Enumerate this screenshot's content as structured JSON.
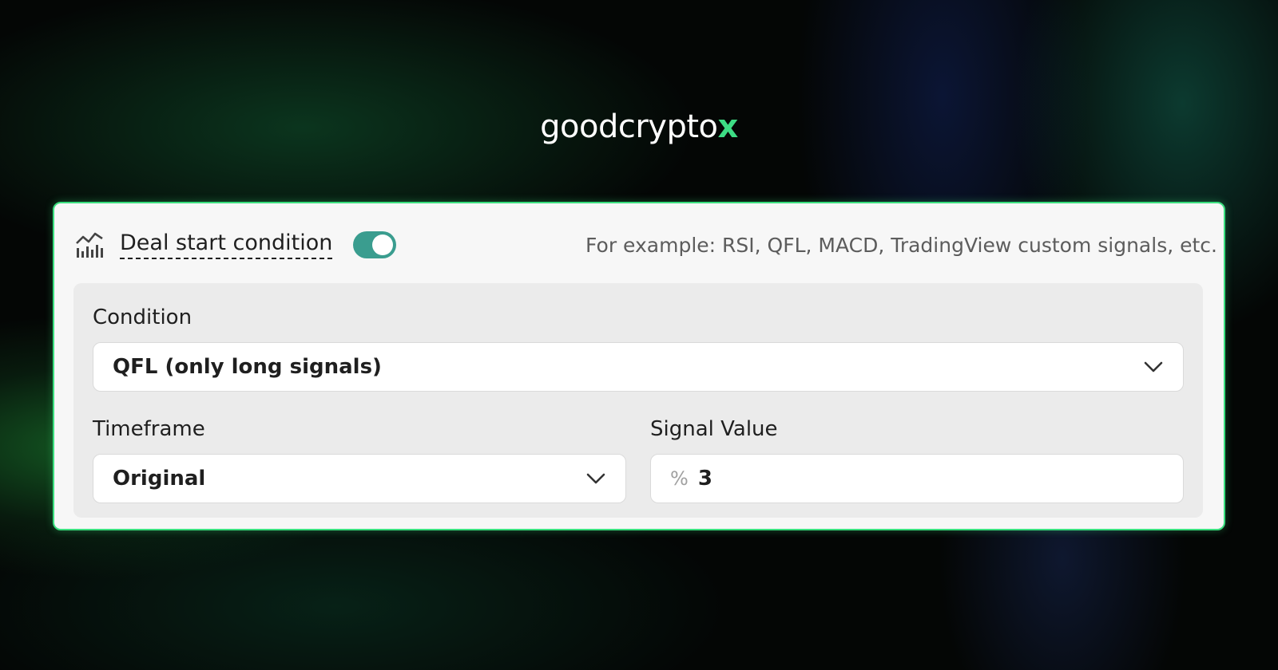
{
  "brand": {
    "logo_main": "goodcrypto",
    "logo_x": "x",
    "accent_color": "#3ddc84"
  },
  "card": {
    "icon": "bar-line-chart-icon",
    "title": "Deal start condition",
    "toggle_on": true,
    "toggle_color": "#3a9d8f",
    "hint": "For example: RSI, QFL, MACD, TradingView custom signals, etc."
  },
  "form": {
    "condition": {
      "label": "Condition",
      "value": "QFL (only long signals)"
    },
    "timeframe": {
      "label": "Timeframe",
      "value": "Original"
    },
    "signal_value": {
      "label": "Signal Value",
      "prefix": "%",
      "value": "3"
    }
  }
}
